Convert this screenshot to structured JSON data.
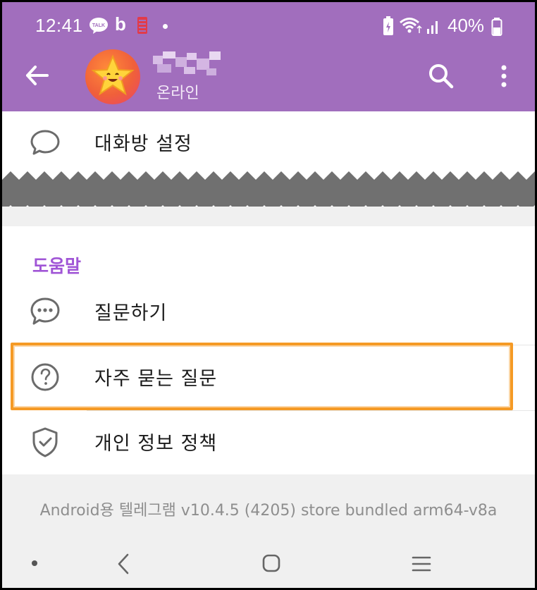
{
  "status_bar": {
    "time": "12:41",
    "talk_badge": "TALK",
    "b_icon": "b",
    "battery_percent": "40%",
    "icons": [
      "kakaotalk-icon",
      "bing-icon",
      "app-notification-icon",
      "battery-saver-icon",
      "wifi-icon",
      "signal-icon",
      "battery-icon"
    ]
  },
  "header": {
    "chat_status": "온라인",
    "colors": {
      "background": "#a16ebd",
      "accent": "#a055d6"
    }
  },
  "rows": {
    "chat_settings": "대화방 설정",
    "ask_question": "질문하기",
    "faq": "자주 묻는 질문",
    "privacy_policy": "개인 정보 정책"
  },
  "section": {
    "title": "도움말"
  },
  "footer": {
    "version": "Android용 텔레그램 v10.4.5 (4205) store bundled arm64-v8a"
  },
  "highlight_color": "#f59a25"
}
